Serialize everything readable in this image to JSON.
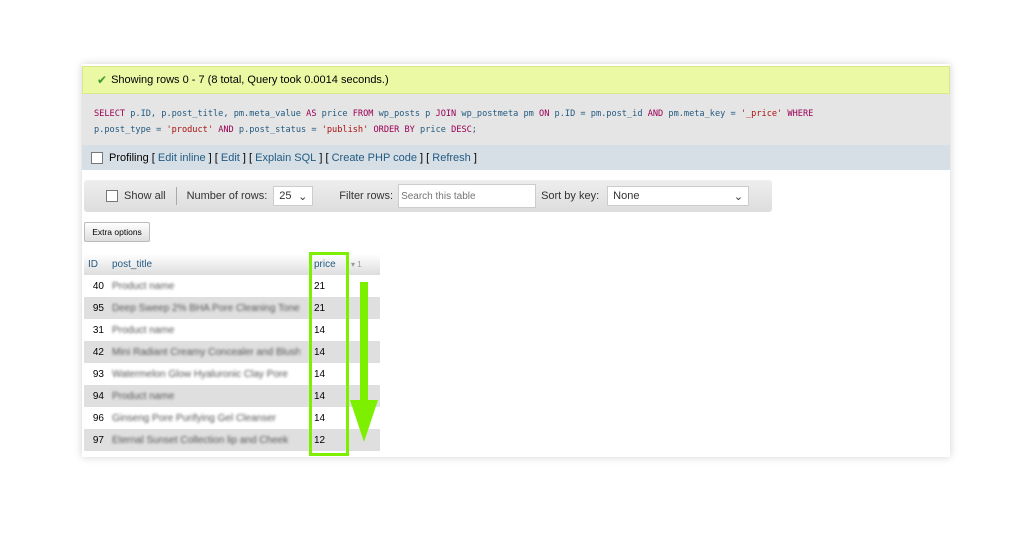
{
  "status": {
    "icon": "check-icon",
    "text": "Showing rows 0 - 7 (8 total, Query took 0.0014 seconds.)"
  },
  "sql": {
    "line1": [
      "SELECT",
      " p.ID, p.post_title, pm.meta_value ",
      "AS",
      " price ",
      "FROM",
      " wp_posts p ",
      "JOIN",
      " wp_postmeta pm ",
      "ON",
      " p.ID = pm.post_id ",
      "AND",
      " pm.meta_key = ",
      "'_price'",
      " ",
      "WHERE"
    ],
    "line2": [
      "p.post_type = ",
      "'product'",
      " ",
      "AND",
      " p.post_status = ",
      "'publish'",
      " ",
      "ORDER BY",
      " price ",
      "DESC",
      ";"
    ]
  },
  "profiling": {
    "label": "Profiling",
    "links": [
      "Edit inline",
      "Edit",
      "Explain SQL",
      "Create PHP code",
      "Refresh"
    ]
  },
  "toolbar": {
    "show_all": "Show all",
    "rows_label": "Number of rows:",
    "rows_value": "25",
    "filter_label": "Filter rows:",
    "filter_placeholder": "Search this table",
    "sort_label": "Sort by key:",
    "sort_value": "None"
  },
  "extra_options": "Extra options",
  "table": {
    "headers": [
      "ID",
      "post_title",
      "price"
    ],
    "sort_indicator": "▾ 1",
    "rows": [
      [
        "40",
        "Product name",
        "21"
      ],
      [
        "95",
        "Deep Sweep 2% BHA Pore Cleaning Toner",
        "21"
      ],
      [
        "31",
        "Product name",
        "14"
      ],
      [
        "42",
        "Mini Radiant Creamy Concealer and Blush",
        "14"
      ],
      [
        "93",
        "Watermelon Glow Hyaluronic Clay Pore",
        "14"
      ],
      [
        "94",
        "Product name",
        "14"
      ],
      [
        "96",
        "Ginseng Pore Purifying Gel Cleanser",
        "14"
      ],
      [
        "97",
        "Eternal Sunset Collection lip and Cheek",
        "12"
      ]
    ]
  },
  "highlight_color": "#7cf000"
}
